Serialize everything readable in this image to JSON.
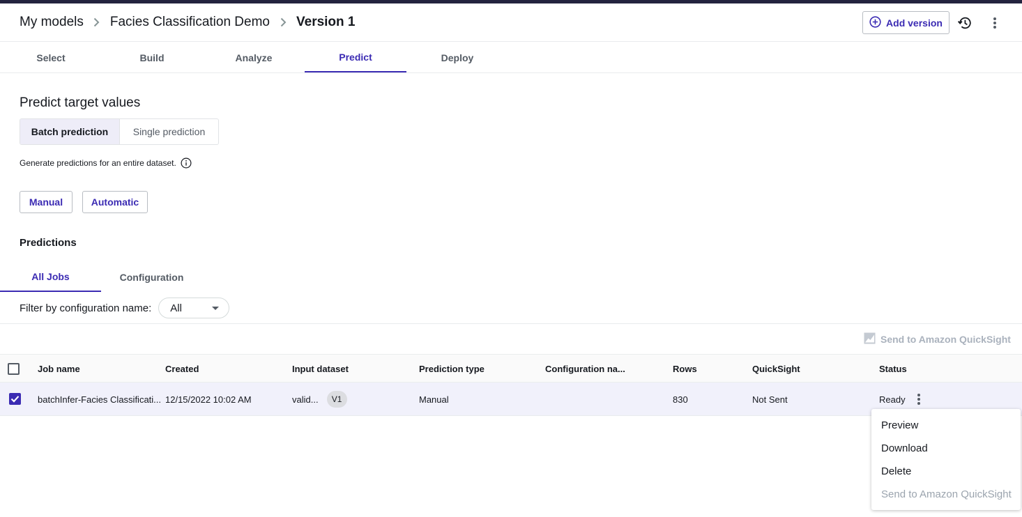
{
  "breadcrumb": {
    "items": [
      "My models",
      "Facies Classification Demo",
      "Version 1"
    ]
  },
  "header": {
    "add_version_label": "Add version"
  },
  "main_tabs": [
    "Select",
    "Build",
    "Analyze",
    "Predict",
    "Deploy"
  ],
  "active_main_tab": "Predict",
  "predict": {
    "title": "Predict target values",
    "mode_tabs": [
      "Batch prediction",
      "Single prediction"
    ],
    "description": "Generate predictions for an entire dataset.",
    "manual_label": "Manual",
    "automatic_label": "Automatic"
  },
  "predictions": {
    "title": "Predictions",
    "sub_tabs": [
      "All Jobs",
      "Configuration"
    ],
    "filter_label": "Filter by configuration name:",
    "filter_value": "All",
    "send_quicksight_label": "Send to Amazon QuickSight"
  },
  "table": {
    "columns": [
      "Job name",
      "Created",
      "Input dataset",
      "Prediction type",
      "Configuration na...",
      "Rows",
      "QuickSight",
      "Status"
    ],
    "rows": [
      {
        "job_name": "batchInfer-Facies Classificati...",
        "created": "12/15/2022 10:02 AM",
        "input_dataset": "valid...",
        "dataset_version": "V1",
        "prediction_type": "Manual",
        "configuration_name": "",
        "rows": "830",
        "quicksight": "Not Sent",
        "status": "Ready",
        "selected": true
      }
    ]
  },
  "context_menu": {
    "items": [
      "Preview",
      "Download",
      "Delete",
      "Send to Amazon QuickSight"
    ]
  },
  "colors": {
    "accent": "#3b2bb3",
    "topbar": "#23233f",
    "selected_row": "#f1f1fb",
    "disabled_text": "#9ba4ae"
  }
}
